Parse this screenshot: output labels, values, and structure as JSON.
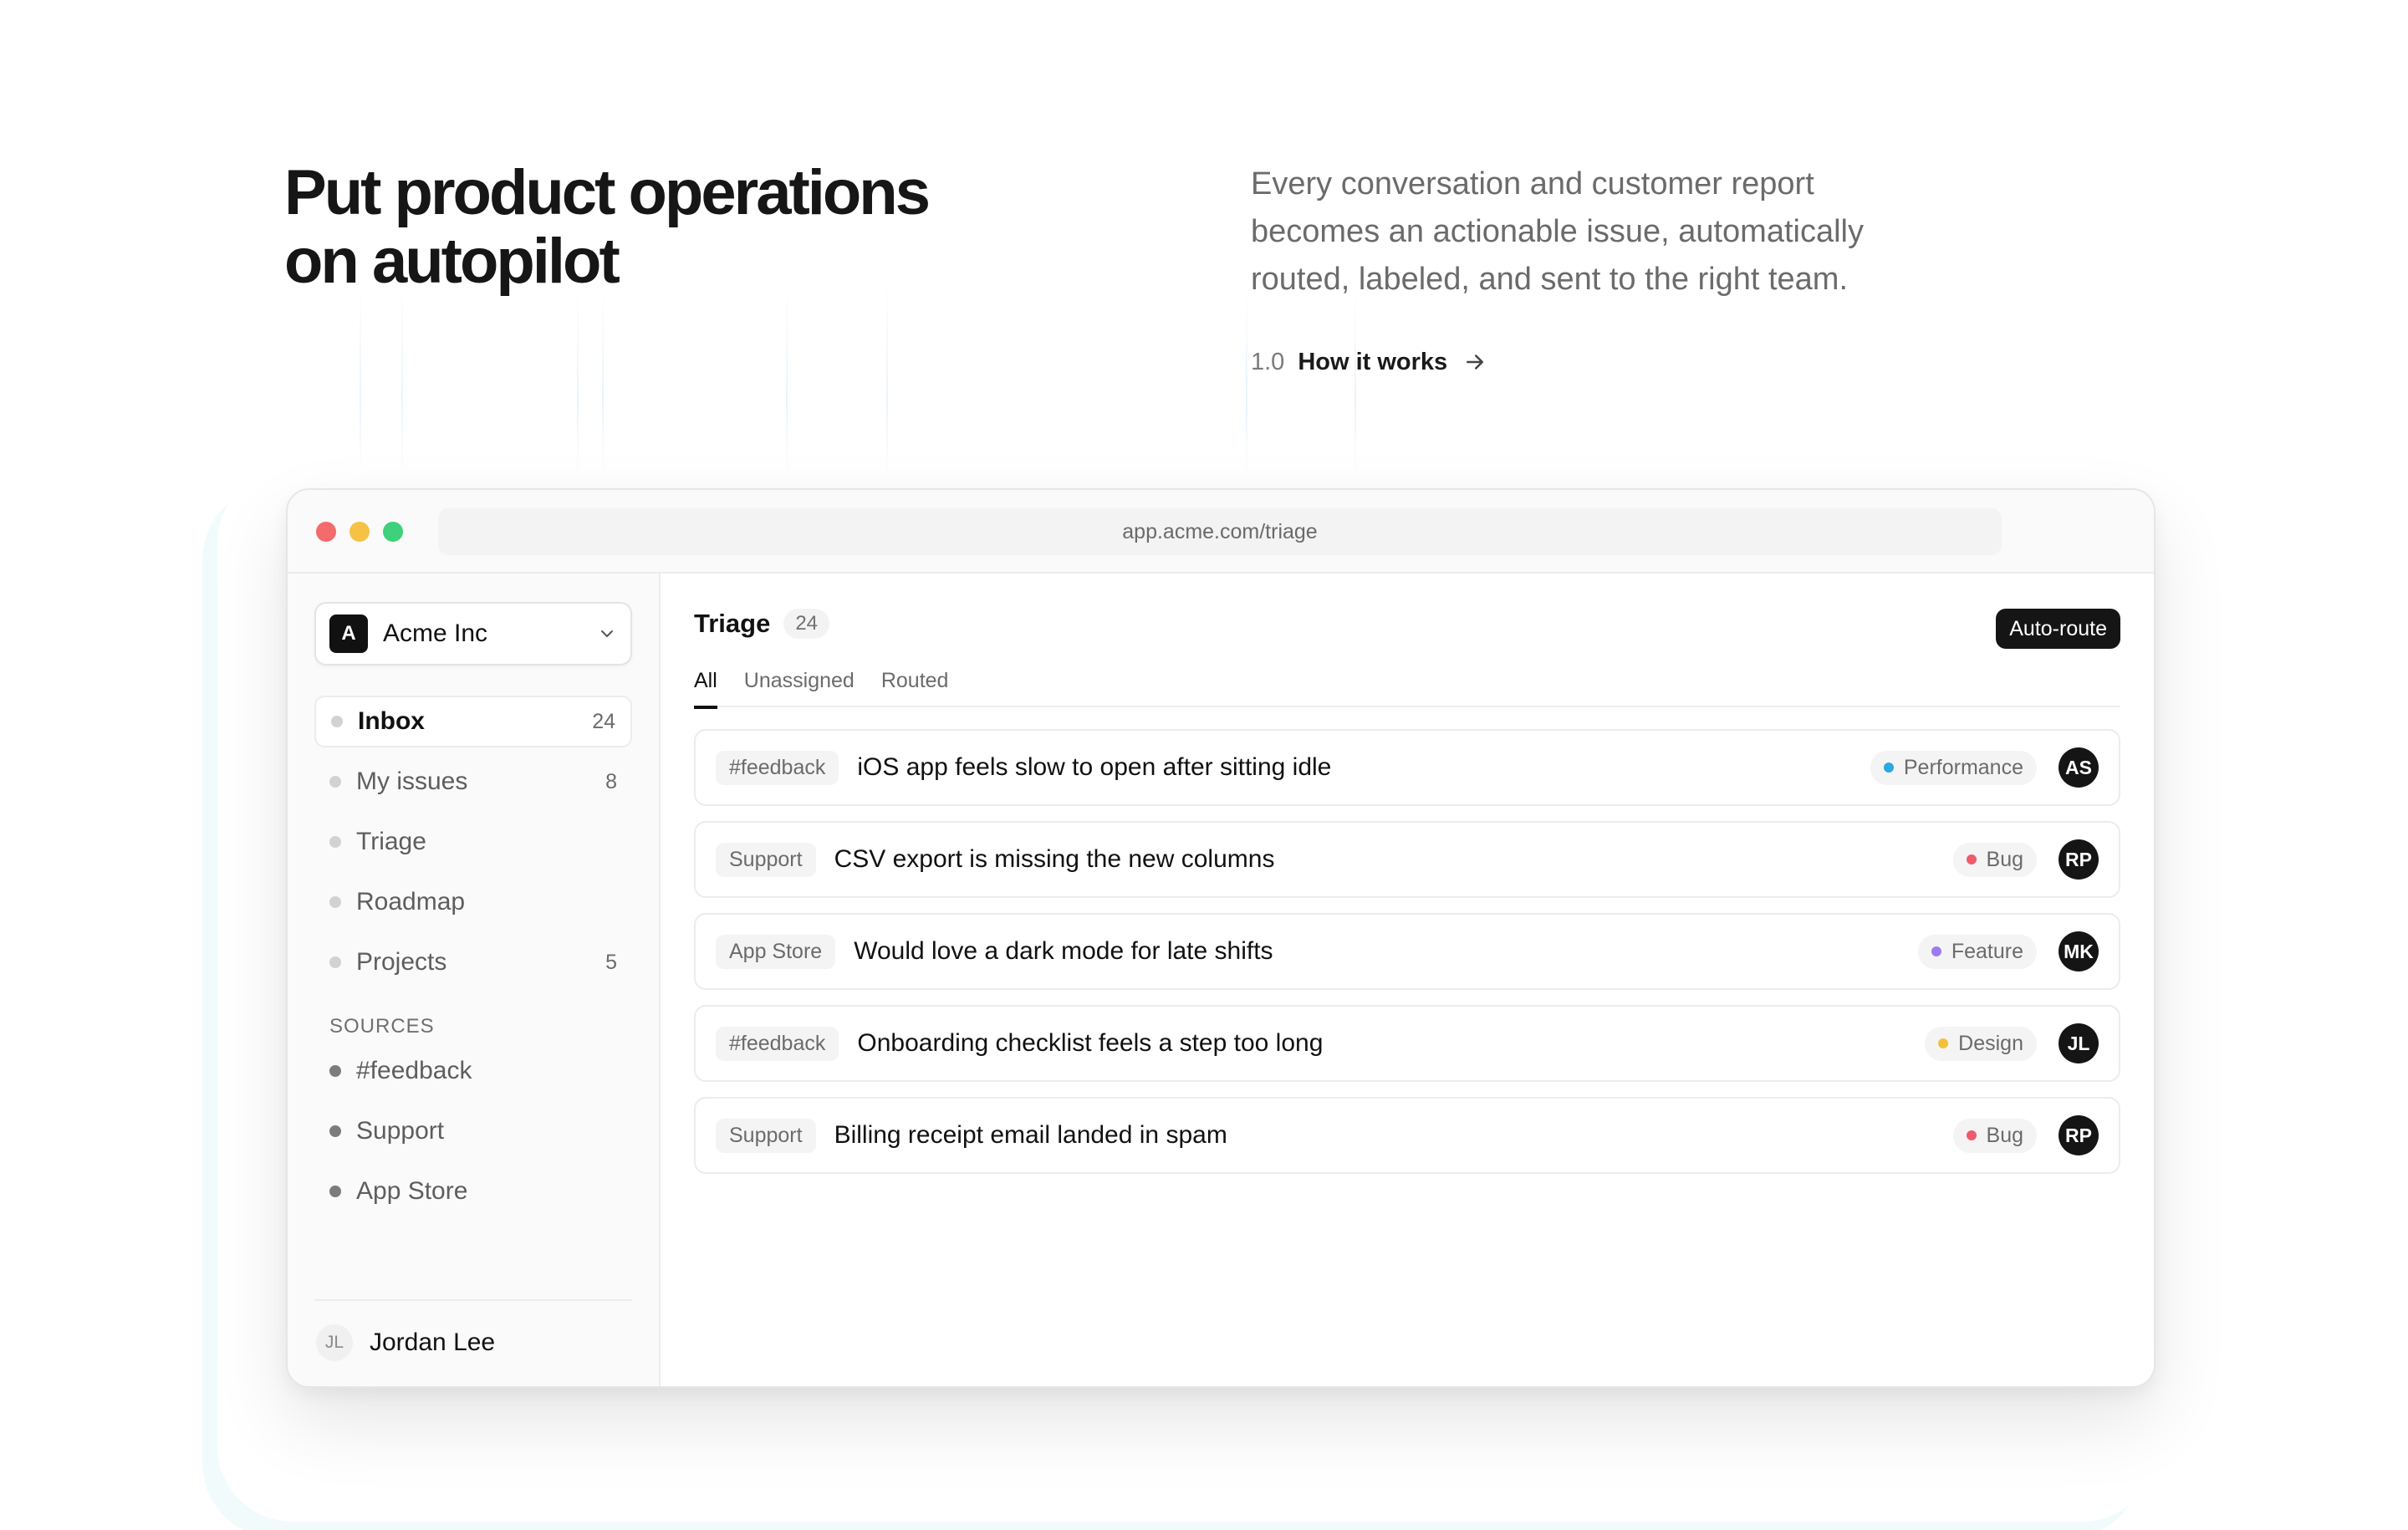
{
  "hero": {
    "title_line1": "Put product operations",
    "title_line2": "on autopilot",
    "description_line1": "Every conversation and customer report",
    "description_line2": "becomes an actionable issue, automatically",
    "description_line3": "routed, labeled, and sent to the right team.",
    "link_number": "1.0",
    "link_label": "How it works",
    "link_icon": "arrow-right-icon"
  },
  "window": {
    "url": "app.acme.com/triage",
    "controls": {
      "close_color": "#f56b6b",
      "minimize_color": "#f6c244",
      "maximize_color": "#3ed07a"
    }
  },
  "sidebar": {
    "workspace": {
      "logo_letter": "A",
      "name": "Acme Inc",
      "icon": "chevron-down-icon"
    },
    "nav": [
      {
        "label": "Inbox",
        "count": "24",
        "active": true
      },
      {
        "label": "My issues",
        "count": "8"
      },
      {
        "label": "Triage",
        "count": ""
      },
      {
        "label": "Roadmap",
        "count": ""
      },
      {
        "label": "Projects",
        "count": "5"
      }
    ],
    "sources_title": "SOURCES",
    "sources": [
      {
        "label": "#feedback"
      },
      {
        "label": "Support"
      },
      {
        "label": "App Store"
      }
    ],
    "user": {
      "initials": "JL",
      "name": "Jordan Lee"
    }
  },
  "main": {
    "title": "Triage",
    "count": "24",
    "action_label": "Auto-route",
    "tabs": [
      {
        "label": "All",
        "active": true
      },
      {
        "label": "Unassigned"
      },
      {
        "label": "Routed"
      }
    ],
    "issues": [
      {
        "source": "#feedback",
        "title": "iOS app feels slow to open after sitting idle",
        "tag": "Performance",
        "tag_color": "#2aa8e0",
        "assignee": "AS"
      },
      {
        "source": "Support",
        "title": "CSV export is missing the new columns",
        "tag": "Bug",
        "tag_color": "#ef5b6a",
        "assignee": "RP"
      },
      {
        "source": "App Store",
        "title": "Would love a dark mode for late shifts",
        "tag": "Feature",
        "tag_color": "#9b7bf0",
        "assignee": "MK"
      },
      {
        "source": "#feedback",
        "title": "Onboarding checklist feels a step too long",
        "tag": "Design",
        "tag_color": "#f3c03c",
        "assignee": "JL"
      },
      {
        "source": "Support",
        "title": "Billing receipt email landed in spam",
        "tag": "Bug",
        "tag_color": "#ef5b6a",
        "assignee": "RP"
      }
    ]
  }
}
